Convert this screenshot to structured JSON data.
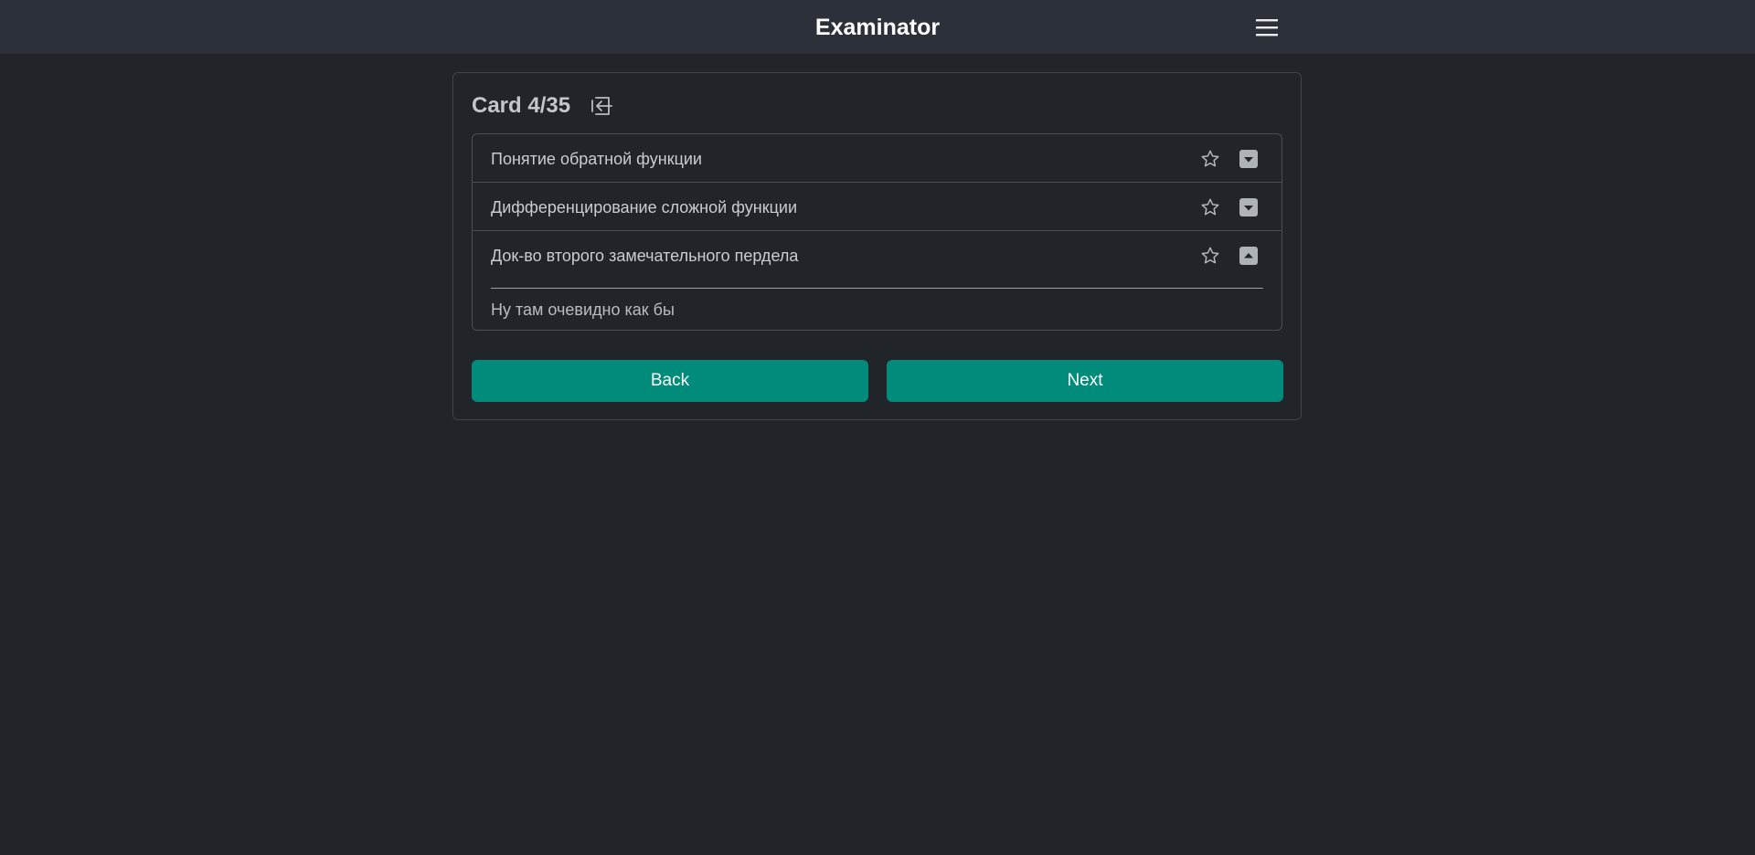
{
  "app": {
    "title": "Examinator"
  },
  "card": {
    "title": "Card 4/35",
    "items": [
      {
        "title": "Понятие обратной функции",
        "expanded": false,
        "answer": ""
      },
      {
        "title": "Дифференцирование сложной функции",
        "expanded": false,
        "answer": ""
      },
      {
        "title": "Док-во второго замечательного пердела",
        "expanded": true,
        "answer": "Ну там очевидно как бы"
      }
    ]
  },
  "buttons": {
    "back": "Back",
    "next": "Next"
  },
  "icons": {
    "menu": "hamburger-menu-icon",
    "exit": "box-arrow-in-left-icon",
    "favorite": "star-outline-icon",
    "expand": "caret-down-square-icon",
    "collapse": "caret-up-square-icon"
  },
  "colors": {
    "background": "#212529",
    "navbar": "#2c3038",
    "accent": "#008b7a"
  }
}
